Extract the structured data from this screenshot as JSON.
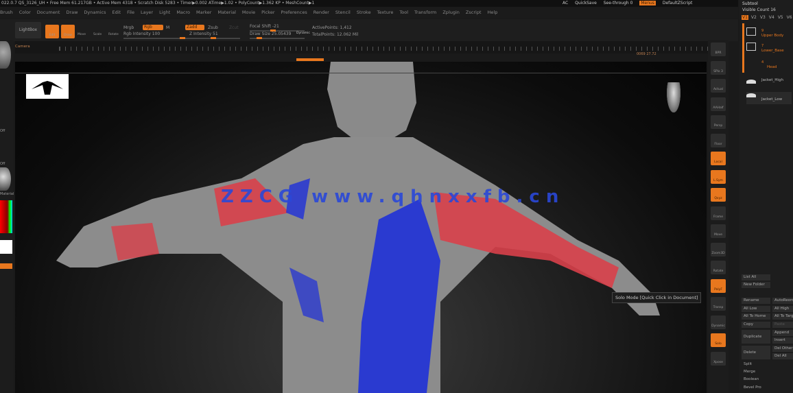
{
  "status": {
    "version": "022.0.7 QS_3126_UH",
    "free_mem": "Free Mem 61.217GB",
    "active_mem": "Active Mem 4318",
    "scratch": "Scratch Disk 5283",
    "timer": "Timer▶0.002 ATime▶1.02",
    "polycount": "PolyCount▶1.362 KP",
    "meshcount": "MeshCount▶1"
  },
  "topright": {
    "ac": "AC",
    "quicksave": "QuickSave",
    "see_through": "See-through 0",
    "menus": "Menus",
    "default_zscript": "DefaultZScript"
  },
  "menu": [
    "Brush",
    "Color",
    "Document",
    "Draw",
    "Dynamics",
    "Edit",
    "File",
    "Layer",
    "Light",
    "Macro",
    "Marker",
    "Material",
    "Movie",
    "Picker",
    "Preferences",
    "Render",
    "Stencil",
    "Stroke",
    "Texture",
    "Tool",
    "Transform",
    "Zplugin",
    "Zscript",
    "Help"
  ],
  "toolbar": {
    "lightbox": "LightBox",
    "edit": "Edit",
    "draw": "Draw",
    "move": "Move",
    "scale": "Scale",
    "rotate": "Rotate",
    "mrgb": "Mrgb",
    "rgb": "Rgb",
    "m": "M",
    "zadd": "Zadd",
    "zsub": "Zsub",
    "zcut": "Zcut",
    "rgb_intensity": "Rgb Intensity 100",
    "z_intensity": "Z Intensity 51",
    "focal_shift": "Focal Shift -21",
    "draw_size": "Draw Size 25.05439",
    "dynamic": "Dynamic",
    "active_points": "ActivePoints: 1,412",
    "total_points": "TotalPoints: 12.062 Mil",
    "rgb_intensity_value": 100,
    "z_intensity_value": 51
  },
  "timeline": {
    "label": "Camera",
    "time": "0069 27.72"
  },
  "left_panel": {
    "labels": [
      "Off",
      "Off",
      "Material"
    ]
  },
  "right_icons": [
    "BPR",
    "SPix 3",
    "Actual",
    "AAHalf",
    "Persp",
    "Floor",
    "Local",
    "L.Sym",
    "Qxyz",
    "Frame",
    "Move",
    "Zoom3D",
    "Rotate",
    "PolyF",
    "Transp",
    "Dynamic",
    "Solo",
    "Xpose"
  ],
  "subtool": {
    "title": "Subtool",
    "visible_count": "Visible Count 16",
    "versions": [
      "V1",
      "V2",
      "V3",
      "V4",
      "V5",
      "V6",
      "V7"
    ],
    "items": [
      {
        "count": "9",
        "name": "Upper Body"
      },
      {
        "count": "7",
        "name": "Lower_Base"
      },
      {
        "count": "4",
        "name": "Head"
      },
      {
        "name": "Jacket_High"
      },
      {
        "name": "Jacket_Low"
      }
    ],
    "buttons": [
      "List All",
      "New Folder",
      "Rename",
      "AutoReorder",
      "All Low",
      "All High",
      "All To Home",
      "All To Target",
      "Copy",
      "Paste",
      "Duplicate",
      "Append",
      "Insert",
      "Delete",
      "Del Other",
      "Del All",
      "Split",
      "Merge",
      "Boolean",
      "Bevel Pro"
    ]
  },
  "tooltip": "Solo Mode [Quick Click in Document]",
  "watermark": "ZZCG www.qhnxxfb.cn",
  "colors": {
    "accent": "#e8771e",
    "mask_red": "#d8404a",
    "mask_blue": "#2a3ad0"
  }
}
